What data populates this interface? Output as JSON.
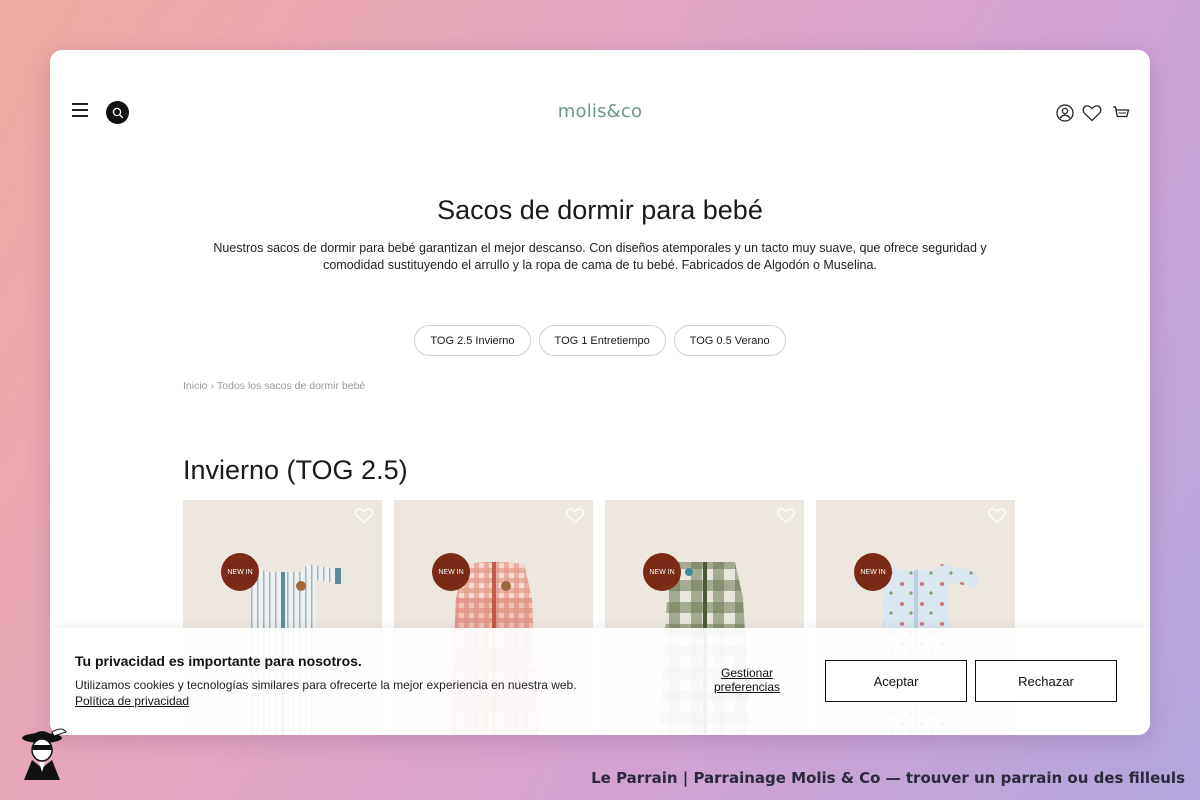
{
  "header": {
    "logo": "molis&co"
  },
  "hero": {
    "title": "Sacos de dormir para bebé",
    "description": "Nuestros sacos de dormir para bebé garantizan el mejor descanso. Con diseños atemporales y un tacto muy suave, que ofrece seguridad y comodidad sustituyendo el arrullo y la ropa de cama de tu bebé. Fabricados de Algodón o Muselina."
  },
  "filters": [
    "TOG 2.5 Invierno",
    "TOG 1 Entretiempo",
    "TOG 0.5 Verano"
  ],
  "breadcrumb": {
    "home": "Inicio",
    "sep": "›",
    "current": "Todos los sacos de dormir bebé"
  },
  "section": {
    "title": "Invierno (TOG 2.5)"
  },
  "products": [
    {
      "badge": "NEW IN",
      "pattern": "stripes",
      "color": "#8aa8b0"
    },
    {
      "badge": "NEW IN",
      "pattern": "gingham",
      "color": "#d9786a"
    },
    {
      "badge": "NEW IN",
      "pattern": "check",
      "color": "#6b7a55"
    },
    {
      "badge": "NEW IN",
      "pattern": "dots",
      "color": "#c9dbe8"
    }
  ],
  "cookie": {
    "title": "Tu privacidad es importante para nosotros.",
    "text": "Utilizamos cookies y tecnologías similares para ofrecerte la mejor experiencia en nuestra web.",
    "policy_link": "Política de privacidad",
    "manage": "Gestionar preferencias",
    "accept": "Aceptar",
    "reject": "Rechazar"
  },
  "footer": {
    "text": "Le Parrain | Parrainage Molis & Co — trouver un parrain ou des filleuls"
  },
  "colors": {
    "logo": "#6b9985",
    "badge": "#7a2a17"
  }
}
